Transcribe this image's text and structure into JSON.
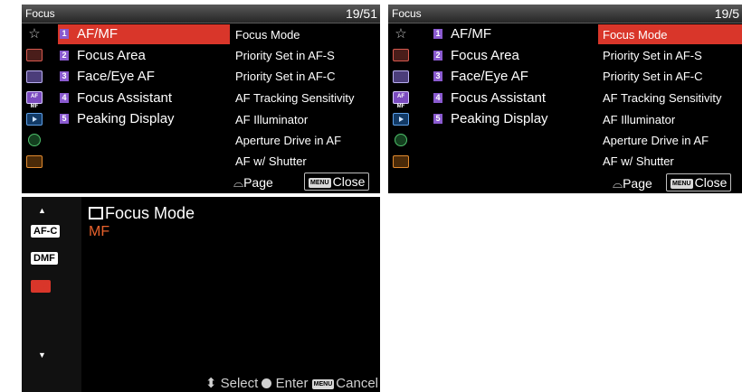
{
  "menu": {
    "title": "Focus",
    "page": "19/51",
    "page_cropped": "19/5",
    "tab_icons": [
      "star-icon",
      "camera-icon",
      "image-icon",
      "af-mf-icon",
      "play-icon",
      "network-icon",
      "toolbox-icon"
    ],
    "left_items": [
      {
        "num": "1",
        "label": "AF/MF"
      },
      {
        "num": "2",
        "label": "Focus Area"
      },
      {
        "num": "3",
        "label": "Face/Eye AF"
      },
      {
        "num": "4",
        "label": "Focus Assistant"
      },
      {
        "num": "5",
        "label": "Peaking Display"
      }
    ],
    "right_items": [
      "Focus Mode",
      "Priority Set in AF-S",
      "Priority Set in AF-C",
      "AF Tracking Sensitivity",
      "AF Illuminator",
      "Aperture Drive in AF",
      "AF w/ Shutter"
    ],
    "footer": {
      "page_label": "Page",
      "menu_key": "MENU",
      "close_label": "Close"
    }
  },
  "focus_mode_screen": {
    "title": "Focus Mode",
    "value": "MF",
    "options": [
      "AF-C",
      "DMF",
      "MF"
    ],
    "selected_option": "MF",
    "footer": {
      "select_label": "Select",
      "enter_label": "Enter",
      "menu_key": "MENU",
      "cancel_label": "Cancel"
    }
  },
  "colors": {
    "selection": "#d9362a",
    "accent_value": "#e8612c",
    "tab_highlight": "#7b4bbf"
  }
}
